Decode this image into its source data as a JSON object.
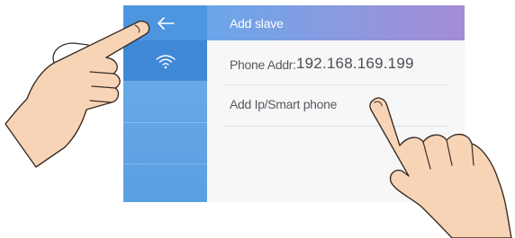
{
  "header": {
    "title": "Add slave"
  },
  "rows": {
    "phone_addr_label": "Phone Addr:",
    "phone_addr_value": "192.168.169.199",
    "add_phone_label": "Add Ip/Smart phone"
  },
  "sidebar": {
    "back_icon": "arrow-left-icon",
    "wifi_icon": "wifi-icon"
  },
  "colors": {
    "sidebar": "#5a9fe2",
    "sidebar_active": "#3f88d6",
    "header_start": "#6aa7ea",
    "header_end": "#a58bd6"
  }
}
